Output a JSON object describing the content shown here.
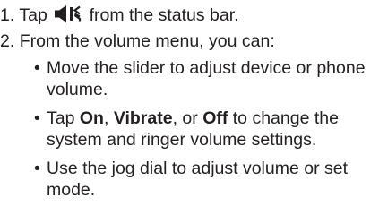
{
  "steps": [
    {
      "number": "1.",
      "before": "Tap",
      "icon": "speaker-volume-icon",
      "after": "from the status bar."
    },
    {
      "number": "2.",
      "text": "From the volume menu, you can:"
    }
  ],
  "bullets": [
    {
      "marker": "•",
      "text": "Move the slider to adjust device or phone volume."
    },
    {
      "marker": "•",
      "prefix": "Tap",
      "on": "On",
      "sep1": ",",
      "vibrate": "Vibrate",
      "sep2": ", or",
      "off": "Off",
      "suffix": "to change the system and ringer volume settings."
    },
    {
      "marker": "•",
      "text": "Use the jog dial to adjust volume or set mode."
    }
  ]
}
